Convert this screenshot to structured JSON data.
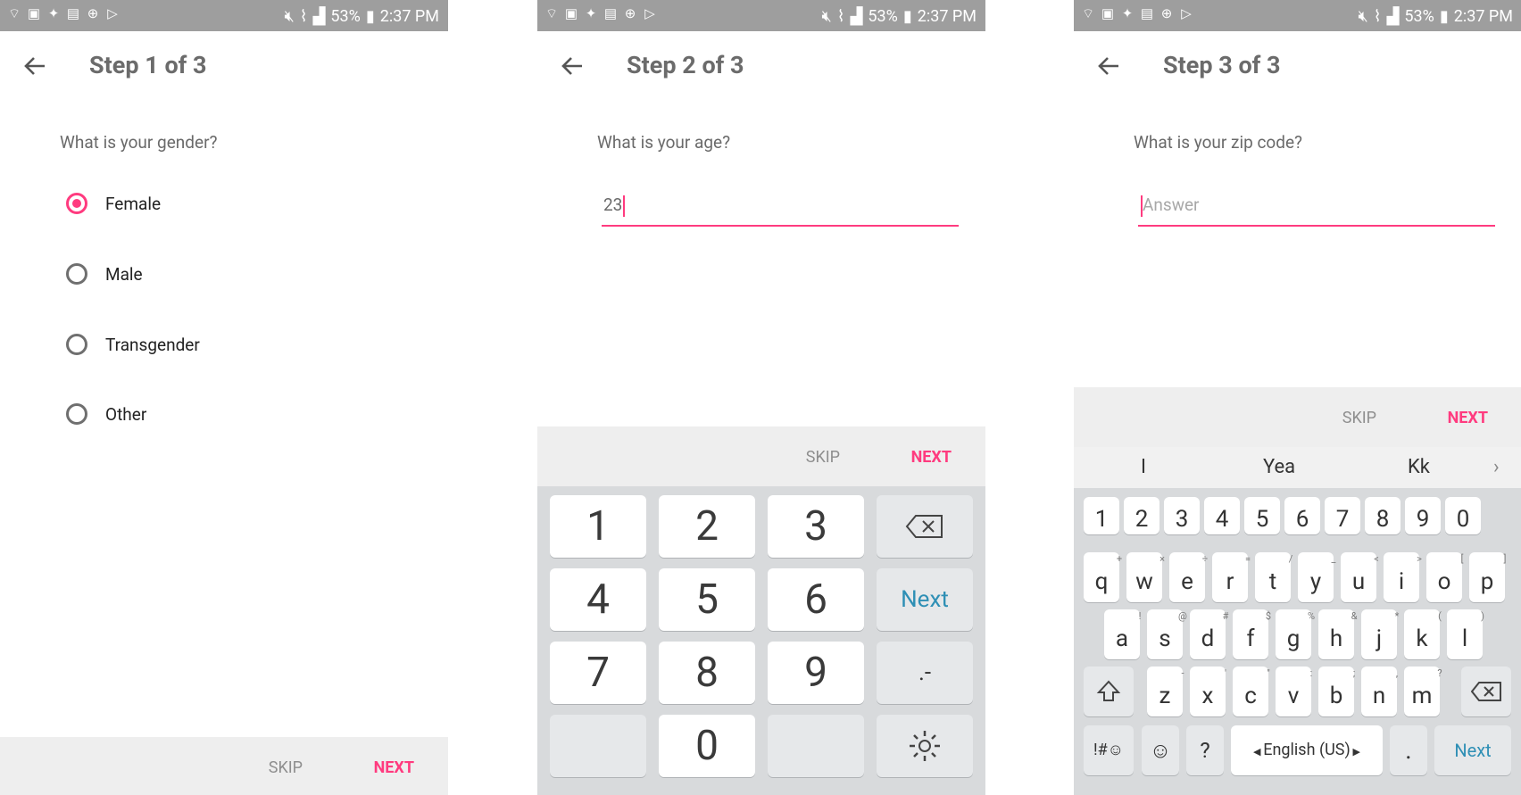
{
  "status": {
    "battery": "53%",
    "time": "2:37 PM"
  },
  "screen1": {
    "title": "Step 1 of 3",
    "question": "What is your gender?",
    "options": [
      "Female",
      "Male",
      "Transgender",
      "Other"
    ],
    "selected": "Female",
    "skip": "SKIP",
    "next": "NEXT"
  },
  "screen2": {
    "title": "Step 2 of 3",
    "question": "What is your age?",
    "value": "23",
    "skip": "SKIP",
    "next": "NEXT",
    "keys": {
      "k1": "1",
      "k2": "2",
      "k3": "3",
      "k4": "4",
      "k5": "5",
      "k6": "6",
      "k7": "7",
      "k8": "8",
      "k9": "9",
      "k0": "0",
      "next": "Next",
      "dotdash": ".-"
    }
  },
  "screen3": {
    "title": "Step 3 of 3",
    "question": "What is your zip code?",
    "placeholder": "Answer",
    "skip": "SKIP",
    "next": "NEXT",
    "suggestions": [
      "I",
      "Yea",
      "Kk"
    ],
    "digits": [
      "1",
      "2",
      "3",
      "4",
      "5",
      "6",
      "7",
      "8",
      "9",
      "0"
    ],
    "row1": [
      "q",
      "w",
      "e",
      "r",
      "t",
      "y",
      "u",
      "i",
      "o",
      "p"
    ],
    "row1_sup": [
      "+",
      "×",
      "÷",
      "=",
      "/",
      "_",
      "<",
      ">",
      "[",
      "]"
    ],
    "row2": [
      "a",
      "s",
      "d",
      "f",
      "g",
      "h",
      "j",
      "k",
      "l"
    ],
    "row2_sup": [
      "!",
      "@",
      "#",
      "$",
      "%",
      "&",
      "*",
      "(",
      ")"
    ],
    "row3": [
      "z",
      "x",
      "c",
      "v",
      "b",
      "n",
      "m"
    ],
    "row3_sup": [
      "-",
      "'",
      "\"",
      ":",
      ";",
      ",",
      "?"
    ],
    "symbols": "!#☺",
    "question_key": "?",
    "language": "English (US)",
    "period": ".",
    "next_key": "Next"
  }
}
